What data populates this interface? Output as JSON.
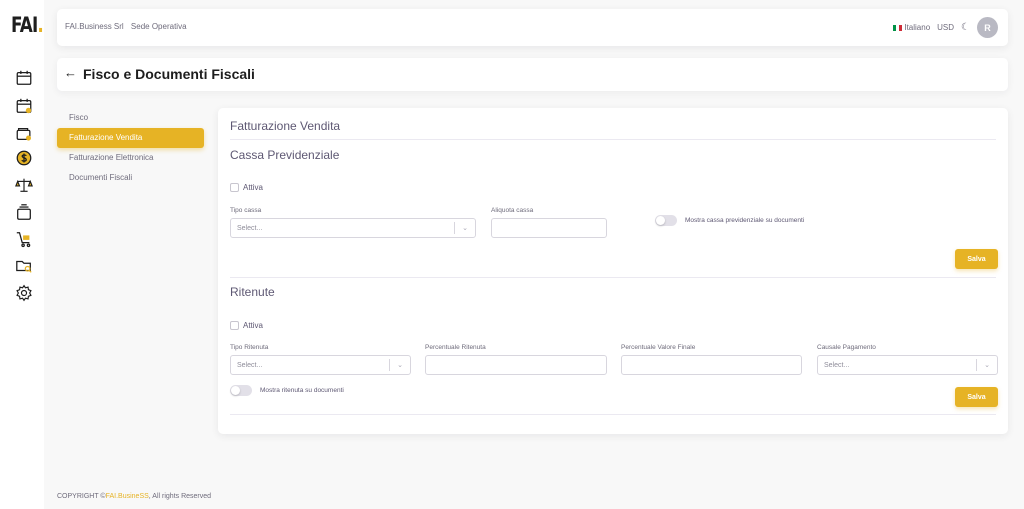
{
  "brand": {
    "logo_text": "FAI",
    "logo_dot": "."
  },
  "navbar": {
    "company": "FAI.Business Srl",
    "location": "Sede Operativa",
    "language": "Italiano",
    "currency": "USD",
    "avatar_initial": "R"
  },
  "sidebar_icons": [
    "calendar-icon",
    "calendar-user-icon",
    "wallet-icon",
    "dollar-icon",
    "scale-icon",
    "layers-icon",
    "cart-icon",
    "folder-search-icon",
    "settings-icon"
  ],
  "page": {
    "title": "Fisco e Documenti Fiscali"
  },
  "tabs": [
    "Fisco",
    "Fatturazione Vendita",
    "Fatturazione Elettronica",
    "Documenti Fiscali"
  ],
  "active_tab": "Fatturazione Vendita",
  "card": {
    "title": "Fatturazione Vendita",
    "cassa": {
      "title": "Cassa Previdenziale",
      "attiva_label": "Attiva",
      "tipo_label": "Tipo cassa",
      "tipo_placeholder": "Select...",
      "aliquota_label": "Aliquota cassa",
      "aliquota_value": "",
      "toggle_label": "Mostra cassa previdenziale su documenti",
      "save_label": "Salva"
    },
    "ritenute": {
      "title": "Ritenute",
      "attiva_label": "Attiva",
      "tipo_label": "Tipo Ritenuta",
      "tipo_placeholder": "Select...",
      "perc_label": "Percentuale Ritenuta",
      "perc_value": "",
      "valore_label": "Percentuale Valore Finale",
      "valore_value": "",
      "causale_label": "Causale Pagamento",
      "causale_placeholder": "Select...",
      "toggle_label": "Mostra ritenuta su documenti",
      "save_label": "Salva"
    }
  },
  "footer": {
    "prefix": "COPYRIGHT ©",
    "brand": "FAI.BusineSS",
    "suffix": ", All rights Reserved"
  },
  "colors": {
    "accent": "#e6b325",
    "text": "#5e5873",
    "background": "#f8f8f8"
  }
}
